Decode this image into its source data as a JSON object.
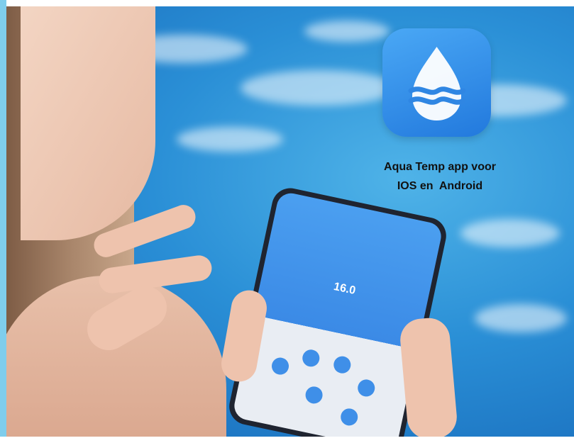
{
  "caption": {
    "line1": "Aqua Temp app voor",
    "line2": "IOS en  Android"
  },
  "app_icon": {
    "icon": "water-drop-waves-icon",
    "background_color": "#2f8be8"
  },
  "phone_screen": {
    "temperature": "16.0"
  },
  "colors": {
    "pool": "#2a8fd6",
    "accent_strip": "#7fcdec"
  }
}
